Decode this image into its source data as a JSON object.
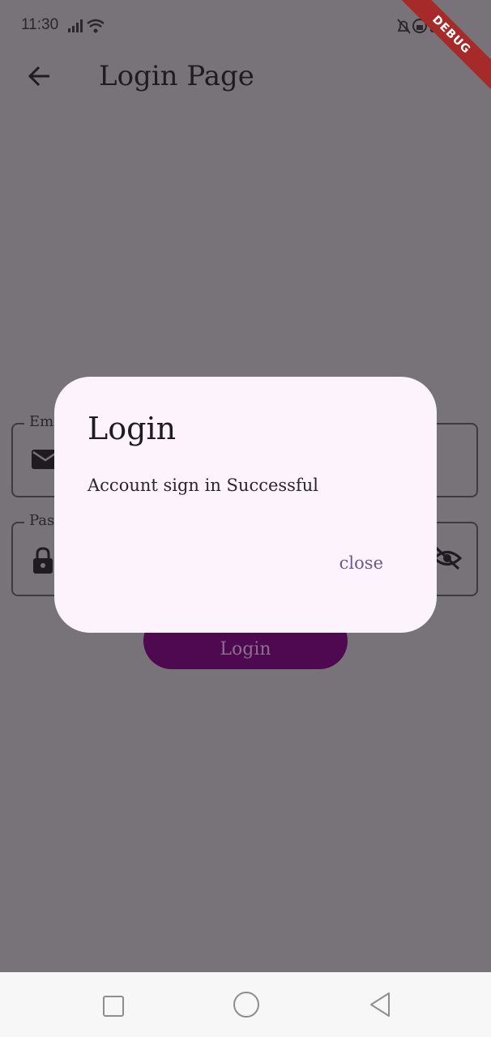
{
  "status_bar": {
    "time": "11:30",
    "left_icons": [
      "signal-icon",
      "wifi-icon"
    ],
    "right_icons": [
      "bell-off-icon",
      "lock-clock-icon",
      "battery-icon"
    ]
  },
  "debug_banner": {
    "label": "DEBUG"
  },
  "app_bar": {
    "title": "Login Page",
    "back_icon": "arrow-left-icon"
  },
  "form": {
    "email": {
      "label": "Em",
      "icon": "envelope-icon"
    },
    "password": {
      "label": "Pas",
      "icon": "lock-icon",
      "suffix_icon": "eye-off-icon"
    },
    "login_label": "Login"
  },
  "dialog": {
    "title": "Login",
    "content": "Account sign in Successful",
    "close_label": "close"
  },
  "nav_bar": {
    "buttons": [
      "recents-square-icon",
      "home-circle-icon",
      "back-triangle-icon"
    ]
  },
  "colors": {
    "scrim": "#787378",
    "dialog_bg": "#fcf3fc",
    "accent": "#6a5a8a",
    "button_bg": "#4e0951",
    "debug": "#a62a2a"
  }
}
